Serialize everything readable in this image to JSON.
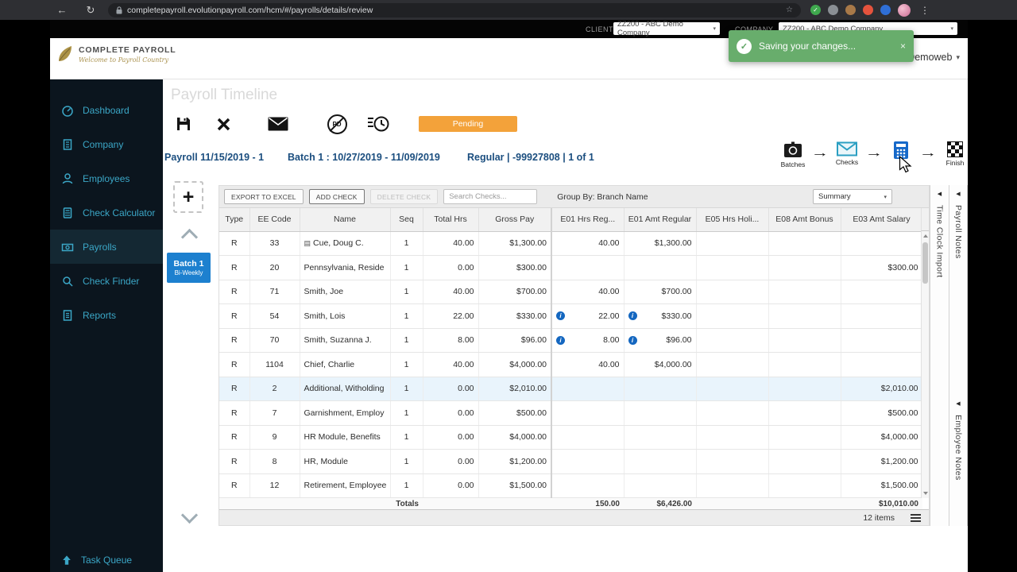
{
  "browser": {
    "url": "completepayroll.evolutionpayroll.com/hcm/#/payrolls/details/review",
    "back": "←",
    "reload": "↻",
    "star": "☆",
    "menu": "⋮",
    "ext_check": "✓"
  },
  "topbar": {
    "client_label": "CLIENT",
    "client_value": "ZZ200 - ABC Demo Company",
    "company_label": "COMPANY",
    "company_value": "ZZ200 - ABC Demo Company",
    "caret": "▾"
  },
  "toast": {
    "check_icon": "✓",
    "message": "Saving your changes...",
    "close_label": "×"
  },
  "header": {
    "logo_title": "COMPLETE PAYROLL",
    "logo_tagline": "Welcome to Payroll Country",
    "user_menu": "Demoweb",
    "caret": "▾"
  },
  "sidebar": {
    "items": [
      {
        "label": "Dashboard"
      },
      {
        "label": "Company"
      },
      {
        "label": "Employees"
      },
      {
        "label": "Check Calculator"
      },
      {
        "label": "Payrolls"
      },
      {
        "label": "Check Finder"
      },
      {
        "label": "Reports"
      }
    ],
    "bottom_label": "Task Queue"
  },
  "main": {
    "page_title": "Payroll Timeline",
    "status_badge": "Pending",
    "payroll_label": "Payroll 11/15/2019 - 1",
    "batch_label": "Batch 1 : 10/27/2019 - 11/09/2019",
    "run_label": "Regular | -99927808 | 1 of 1",
    "timeline": {
      "batches_label": "Batches",
      "checks_label": "Checks",
      "finish_label": "Finish",
      "arrow": "→"
    },
    "batch_tab": {
      "line1": "Batch 1",
      "line2": "Bi-Weekly"
    },
    "toolbar": {
      "export_label": "EXPORT TO EXCEL",
      "add_label": "ADD CHECK",
      "delete_label": "DELETE CHECK",
      "search_placeholder": "Search Checks...",
      "group_by": "Group By: Branch Name",
      "view_value": "Summary",
      "caret": "▾"
    },
    "grid": {
      "columns": [
        "Type",
        "EE Code",
        "Name",
        "Seq",
        "Total Hrs",
        "Gross Pay",
        "E01 Hrs Reg...",
        "E01 Amt Regular",
        "E05 Hrs Holi...",
        "E08 Amt Bonus",
        "E03 Amt Salary"
      ],
      "icons": {
        "note": "▤",
        "info": "i"
      },
      "rows": [
        {
          "type": "R",
          "ee_code": "33",
          "name": "Cue, Doug C.",
          "doc_icon": true,
          "seq": "1",
          "total_hrs": "40.00",
          "gross_pay": "$1,300.00",
          "e01_hrs": "40.00",
          "e01_amt": "$1,300.00",
          "e05_hrs": "",
          "e08_amt": "",
          "e03_amt": ""
        },
        {
          "type": "R",
          "ee_code": "20",
          "name": "Pennsylvania, Reside",
          "seq": "1",
          "total_hrs": "0.00",
          "gross_pay": "$300.00",
          "e01_hrs": "",
          "e01_amt": "",
          "e05_hrs": "",
          "e08_amt": "",
          "e03_amt": "$300.00"
        },
        {
          "type": "R",
          "ee_code": "71",
          "name": "Smith, Joe",
          "seq": "1",
          "total_hrs": "40.00",
          "gross_pay": "$700.00",
          "e01_hrs": "40.00",
          "e01_amt": "$700.00",
          "e05_hrs": "",
          "e08_amt": "",
          "e03_amt": ""
        },
        {
          "type": "R",
          "ee_code": "54",
          "name": "Smith, Lois",
          "seq": "1",
          "total_hrs": "22.00",
          "gross_pay": "$330.00",
          "e01_hrs": "22.00",
          "e01_hrs_info": true,
          "e01_amt": "$330.00",
          "e01_amt_info": true,
          "e05_hrs": "",
          "e08_amt": "",
          "e03_amt": ""
        },
        {
          "type": "R",
          "ee_code": "70",
          "name": "Smith, Suzanna J.",
          "seq": "1",
          "total_hrs": "8.00",
          "gross_pay": "$96.00",
          "e01_hrs": "8.00",
          "e01_hrs_info": true,
          "e01_amt": "$96.00",
          "e01_amt_info": true,
          "e05_hrs": "",
          "e08_amt": "",
          "e03_amt": ""
        },
        {
          "type": "R",
          "ee_code": "1104",
          "name": "Chief, Charlie",
          "seq": "1",
          "total_hrs": "40.00",
          "gross_pay": "$4,000.00",
          "e01_hrs": "40.00",
          "e01_amt": "$4,000.00",
          "e05_hrs": "",
          "e08_amt": "",
          "e03_amt": ""
        },
        {
          "type": "R",
          "ee_code": "2",
          "name": "Additional, Witholding",
          "seq": "1",
          "total_hrs": "0.00",
          "gross_pay": "$2,010.00",
          "e01_hrs": "",
          "e01_amt": "",
          "e05_hrs": "",
          "e08_amt": "",
          "e03_amt": "$2,010.00",
          "highlighted": true
        },
        {
          "type": "R",
          "ee_code": "7",
          "name": "Garnishment, Employ",
          "seq": "1",
          "total_hrs": "0.00",
          "gross_pay": "$500.00",
          "e01_hrs": "",
          "e01_amt": "",
          "e05_hrs": "",
          "e08_amt": "",
          "e03_amt": "$500.00"
        },
        {
          "type": "R",
          "ee_code": "9",
          "name": "HR Module, Benefits",
          "seq": "1",
          "total_hrs": "0.00",
          "gross_pay": "$4,000.00",
          "e01_hrs": "",
          "e01_amt": "",
          "e05_hrs": "",
          "e08_amt": "",
          "e03_amt": "$4,000.00"
        },
        {
          "type": "R",
          "ee_code": "8",
          "name": "HR, Module",
          "seq": "1",
          "total_hrs": "0.00",
          "gross_pay": "$1,200.00",
          "e01_hrs": "",
          "e01_amt": "",
          "e05_hrs": "",
          "e08_amt": "",
          "e03_amt": "$1,200.00"
        },
        {
          "type": "R",
          "ee_code": "12",
          "name": "Retirement, Employee",
          "seq": "1",
          "total_hrs": "0.00",
          "gross_pay": "$1,500.00",
          "e01_hrs": "",
          "e01_amt": "",
          "e05_hrs": "",
          "e08_amt": "",
          "e03_amt": "$1,500.00"
        }
      ],
      "totals": {
        "label": "Totals",
        "e01_hrs": "150.00",
        "e01_amt": "$6,426.00",
        "e03_amt": "$10,010.00"
      },
      "footer_count": "12 items"
    },
    "side_tabs": {
      "collapse": "◀",
      "time_clock": "Time Clock Import",
      "payroll_notes": "Payroll Notes",
      "employee_notes": "Employee Notes"
    }
  }
}
